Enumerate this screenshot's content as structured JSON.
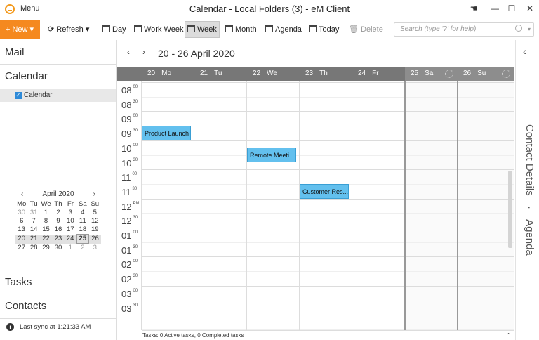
{
  "window": {
    "title": "Calendar - Local Folders (3) - eM Client",
    "menu_label": "Menu"
  },
  "toolbar": {
    "new_label": "New",
    "refresh_label": "Refresh",
    "day_label": "Day",
    "work_week_label": "Work Week",
    "week_label": "Week",
    "month_label": "Month",
    "agenda_label": "Agenda",
    "today_label": "Today",
    "delete_label": "Delete",
    "search_placeholder": "Search (type '?' for help)"
  },
  "sidebar": {
    "mail_label": "Mail",
    "calendar_label": "Calendar",
    "calendar_item": "Calendar",
    "tasks_label": "Tasks",
    "contacts_label": "Contacts",
    "sync_text": "Last sync at 1:21:33 AM",
    "mini_calendar": {
      "month_label": "April 2020",
      "weekdays": [
        "Mo",
        "Tu",
        "We",
        "Th",
        "Fr",
        "Sa",
        "Su"
      ],
      "weeks": [
        [
          "30",
          "31",
          "1",
          "2",
          "3",
          "4",
          "5"
        ],
        [
          "6",
          "7",
          "8",
          "9",
          "10",
          "11",
          "12"
        ],
        [
          "13",
          "14",
          "15",
          "16",
          "17",
          "18",
          "19"
        ],
        [
          "20",
          "21",
          "22",
          "23",
          "24",
          "25",
          "26"
        ],
        [
          "27",
          "28",
          "29",
          "30",
          "1",
          "2",
          "3"
        ]
      ]
    }
  },
  "calendar": {
    "range_label": "20 - 26 April 2020",
    "days": [
      {
        "num": "20",
        "name": "Mo"
      },
      {
        "num": "21",
        "name": "Tu"
      },
      {
        "num": "22",
        "name": "We"
      },
      {
        "num": "23",
        "name": "Th"
      },
      {
        "num": "24",
        "name": "Fr"
      },
      {
        "num": "25",
        "name": "Sa"
      },
      {
        "num": "26",
        "name": "Su"
      }
    ],
    "hours": [
      {
        "h": "08",
        "m": "00"
      },
      {
        "h": "08",
        "m": "30"
      },
      {
        "h": "09",
        "m": "00"
      },
      {
        "h": "09",
        "m": "30"
      },
      {
        "h": "10",
        "m": "00"
      },
      {
        "h": "10",
        "m": "30"
      },
      {
        "h": "11",
        "m": "00"
      },
      {
        "h": "11",
        "m": "30"
      },
      {
        "h": "12",
        "m": "PM"
      },
      {
        "h": "12",
        "m": "30"
      },
      {
        "h": "01",
        "m": "00"
      },
      {
        "h": "01",
        "m": "30"
      },
      {
        "h": "02",
        "m": "00"
      },
      {
        "h": "02",
        "m": "30"
      },
      {
        "h": "03",
        "m": "00"
      },
      {
        "h": "03",
        "m": "30"
      }
    ],
    "events": [
      {
        "title": "Product Launch",
        "day": 0,
        "start": "09:30"
      },
      {
        "title": "Remote Meeti...",
        "day": 2,
        "start": "10:15"
      },
      {
        "title": "Customer Res...",
        "day": 3,
        "start": "11:30"
      }
    ],
    "status_text": "Tasks: 0 Active tasks, 0 Completed tasks"
  },
  "right_panel": {
    "contact_details_label": "Contact Details",
    "separator": "·",
    "agenda_label": "Agenda"
  }
}
